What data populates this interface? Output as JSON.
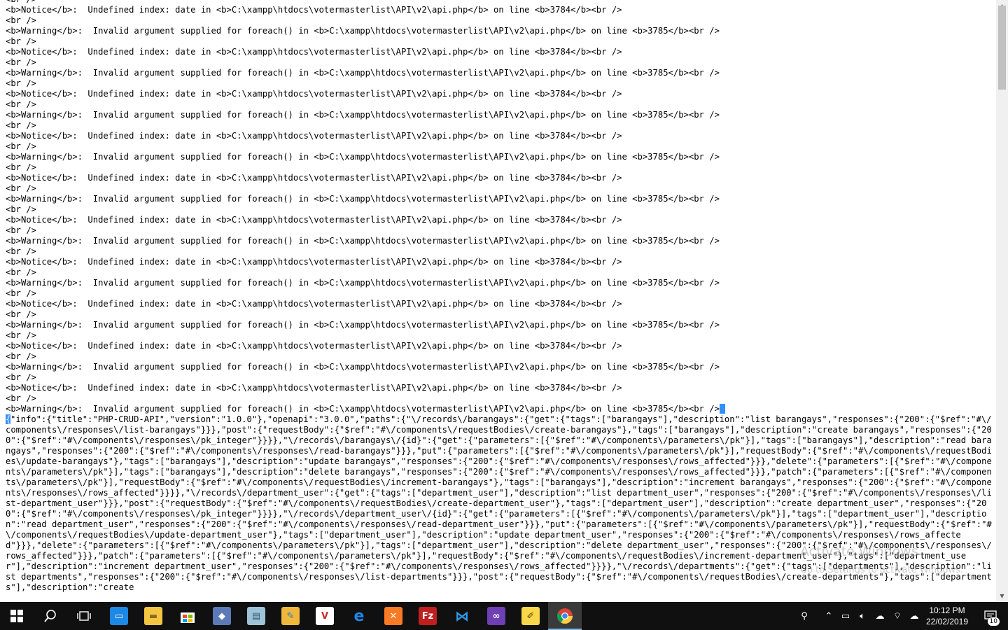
{
  "log": {
    "lines": [
      "<br />",
      "<b>Notice</b>:  Undefined index: date in <b>C:\\xampp\\htdocs\\votermasterlist\\API\\v2\\api.php</b> on line <b>3784</b><br />",
      "<br />",
      "<b>Warning</b>:  Invalid argument supplied for foreach() in <b>C:\\xampp\\htdocs\\votermasterlist\\API\\v2\\api.php</b> on line <b>3785</b><br />",
      "<br />",
      "<b>Notice</b>:  Undefined index: date in <b>C:\\xampp\\htdocs\\votermasterlist\\API\\v2\\api.php</b> on line <b>3784</b><br />",
      "<br />",
      "<b>Warning</b>:  Invalid argument supplied for foreach() in <b>C:\\xampp\\htdocs\\votermasterlist\\API\\v2\\api.php</b> on line <b>3785</b><br />",
      "<br />",
      "<b>Notice</b>:  Undefined index: date in <b>C:\\xampp\\htdocs\\votermasterlist\\API\\v2\\api.php</b> on line <b>3784</b><br />",
      "<br />",
      "<b>Warning</b>:  Invalid argument supplied for foreach() in <b>C:\\xampp\\htdocs\\votermasterlist\\API\\v2\\api.php</b> on line <b>3785</b><br />",
      "<br />",
      "<b>Notice</b>:  Undefined index: date in <b>C:\\xampp\\htdocs\\votermasterlist\\API\\v2\\api.php</b> on line <b>3784</b><br />",
      "<br />",
      "<b>Warning</b>:  Invalid argument supplied for foreach() in <b>C:\\xampp\\htdocs\\votermasterlist\\API\\v2\\api.php</b> on line <b>3785</b><br />",
      "<br />",
      "<b>Notice</b>:  Undefined index: date in <b>C:\\xampp\\htdocs\\votermasterlist\\API\\v2\\api.php</b> on line <b>3784</b><br />",
      "<br />",
      "<b>Warning</b>:  Invalid argument supplied for foreach() in <b>C:\\xampp\\htdocs\\votermasterlist\\API\\v2\\api.php</b> on line <b>3785</b><br />",
      "<br />",
      "<b>Notice</b>:  Undefined index: date in <b>C:\\xampp\\htdocs\\votermasterlist\\API\\v2\\api.php</b> on line <b>3784</b><br />",
      "<br />",
      "<b>Warning</b>:  Invalid argument supplied for foreach() in <b>C:\\xampp\\htdocs\\votermasterlist\\API\\v2\\api.php</b> on line <b>3785</b><br />",
      "<br />",
      "<b>Notice</b>:  Undefined index: date in <b>C:\\xampp\\htdocs\\votermasterlist\\API\\v2\\api.php</b> on line <b>3784</b><br />",
      "<br />",
      "<b>Warning</b>:  Invalid argument supplied for foreach() in <b>C:\\xampp\\htdocs\\votermasterlist\\API\\v2\\api.php</b> on line <b>3785</b><br />",
      "<br />",
      "<b>Notice</b>:  Undefined index: date in <b>C:\\xampp\\htdocs\\votermasterlist\\API\\v2\\api.php</b> on line <b>3784</b><br />",
      "<br />",
      "<b>Warning</b>:  Invalid argument supplied for foreach() in <b>C:\\xampp\\htdocs\\votermasterlist\\API\\v2\\api.php</b> on line <b>3785</b><br />",
      "<br />",
      "<b>Notice</b>:  Undefined index: date in <b>C:\\xampp\\htdocs\\votermasterlist\\API\\v2\\api.php</b> on line <b>3784</b><br />",
      "<br />",
      "<b>Warning</b>:  Invalid argument supplied for foreach() in <b>C:\\xampp\\htdocs\\votermasterlist\\API\\v2\\api.php</b> on line <b>3785</b><br />",
      "<br />",
      "<b>Notice</b>:  Undefined index: date in <b>C:\\xampp\\htdocs\\votermasterlist\\API\\v2\\api.php</b> on line <b>3784</b><br />",
      "<br />"
    ],
    "last_line": "<b>Warning</b>:  Invalid argument supplied for foreach() in <b>C:\\xampp\\htdocs\\votermasterlist\\API\\v2\\api.php</b> on line <b>3785</b><br />",
    "json_first_char": "{",
    "json_body": "\"info\":{\"title\":\"PHP-CRUD-API\",\"version\":\"1.0.0\"},\"openapi\":\"3.0.0\",\"paths\":{\"\\/records\\/barangays\":{\"get\":{\"tags\":[\"barangays\"],\"description\":\"list barangays\",\"responses\":{\"200\":{\"$ref\":\"#\\/components\\/responses\\/list-barangays\"}}},\"post\":{\"requestBody\":{\"$ref\":\"#\\/components\\/requestBodies\\/create-barangays\"},\"tags\":[\"barangays\"],\"description\":\"create barangays\",\"responses\":{\"200\":{\"$ref\":\"#\\/components\\/responses\\/pk_integer\"}}}},\"\\/records\\/barangays\\/{id}\":{\"get\":{\"parameters\":[{\"$ref\":\"#\\/components\\/parameters\\/pk\"}],\"tags\":[\"barangays\"],\"description\":\"read barangays\",\"responses\":{\"200\":{\"$ref\":\"#\\/components\\/responses\\/read-barangays\"}}},\"put\":{\"parameters\":[{\"$ref\":\"#\\/components\\/parameters\\/pk\"}],\"requestBody\":{\"$ref\":\"#\\/components\\/requestBodies\\/update-barangays\"},\"tags\":[\"barangays\"],\"description\":\"update barangays\",\"responses\":{\"200\":{\"$ref\":\"#\\/components\\/responses\\/rows_affected\"}}},\"delete\":{\"parameters\":[{\"$ref\":\"#\\/components\\/parameters\\/pk\"}],\"tags\":[\"barangays\"],\"description\":\"delete barangays\",\"responses\":{\"200\":{\"$ref\":\"#\\/components\\/responses\\/rows_affected\"}}},\"patch\":{\"parameters\":[{\"$ref\":\"#\\/components\\/parameters\\/pk\"}],\"requestBody\":{\"$ref\":\"#\\/components\\/requestBodies\\/increment-barangays\"},\"tags\":[\"barangays\"],\"description\":\"increment barangays\",\"responses\":{\"200\":{\"$ref\":\"#\\/components\\/responses\\/rows_affected\"}}}},\"\\/records\\/department_user\":{\"get\":{\"tags\":[\"department_user\"],\"description\":\"list department_user\",\"responses\":{\"200\":{\"$ref\":\"#\\/components\\/responses\\/list-department_user\"}}},\"post\":{\"requestBody\":{\"$ref\":\"#\\/components\\/requestBodies\\/create-department_user\"},\"tags\":[\"department_user\"],\"description\":\"create department_user\",\"responses\":{\"200\":{\"$ref\":\"#\\/components\\/responses\\/pk_integer\"}}}},\"\\/records\\/department_user\\/{id}\":{\"get\":{\"parameters\":[{\"$ref\":\"#\\/components\\/parameters\\/pk\"}],\"tags\":[\"department_user\"],\"description\":\"read department_user\",\"responses\":{\"200\":{\"$ref\":\"#\\/components\\/responses\\/read-department_user\"}}},\"put\":{\"parameters\":[{\"$ref\":\"#\\/components\\/parameters\\/pk\"}],\"requestBody\":{\"$ref\":\"#\\/components\\/requestBodies\\/update-department_user\"},\"tags\":[\"department_user\"],\"description\":\"update department_user\",\"responses\":{\"200\":{\"$ref\":\"#\\/components\\/responses\\/rows_affected\"}}},\"delete\":{\"parameters\":[{\"$ref\":\"#\\/components\\/parameters\\/pk\"}],\"tags\":[\"department_user\"],\"description\":\"delete department_user\",\"responses\":{\"200\":{\"$ref\":\"#\\/components\\/responses\\/rows_affected\"}}},\"patch\":{\"parameters\":[{\"$ref\":\"#\\/components\\/parameters\\/pk\"}],\"requestBody\":{\"$ref\":\"#\\/components\\/requestBodies\\/increment-department_user\"},\"tags\":[\"department_user\"],\"description\":\"increment department_user\",\"responses\":{\"200\":{\"$ref\":\"#\\/components\\/responses\\/rows_affected\"}}}},\"\\/records\\/departments\":{\"get\":{\"tags\":[\"departments\"],\"description\":\"list departments\",\"responses\":{\"200\":{\"$ref\":\"#\\/components\\/responses\\/list-departments\"}}},\"post\":{\"requestBody\":{\"$ref\":\"#\\/components\\/requestBodies\\/create-departments\"},\"tags\":[\"departments\"],\"description\":\"create"
  },
  "watermark": {
    "title": "Activate Windows",
    "subtitle": "Go to Settings to activate Windows."
  },
  "taskbar": {
    "apps": [
      {
        "name": "start-button-icon"
      },
      {
        "name": "search-icon"
      },
      {
        "name": "task-view-icon"
      },
      {
        "name": "remote-desktop-icon"
      },
      {
        "name": "file-explorer-icon"
      },
      {
        "name": "store-icon"
      },
      {
        "name": "network-tool-icon"
      },
      {
        "name": "notepad-icon"
      },
      {
        "name": "paint-icon"
      },
      {
        "name": "vector-app-icon"
      },
      {
        "name": "edge-icon"
      },
      {
        "name": "xampp-icon"
      },
      {
        "name": "filezilla-icon"
      },
      {
        "name": "vscode-icon"
      },
      {
        "name": "visual-studio-icon"
      },
      {
        "name": "pencil-app-icon"
      },
      {
        "name": "chrome-icon"
      }
    ],
    "clock_time": "10:12 PM",
    "clock_date": "22/02/2019",
    "notification_count": "10",
    "accent": "#76b9ed",
    "background": "#101010"
  }
}
